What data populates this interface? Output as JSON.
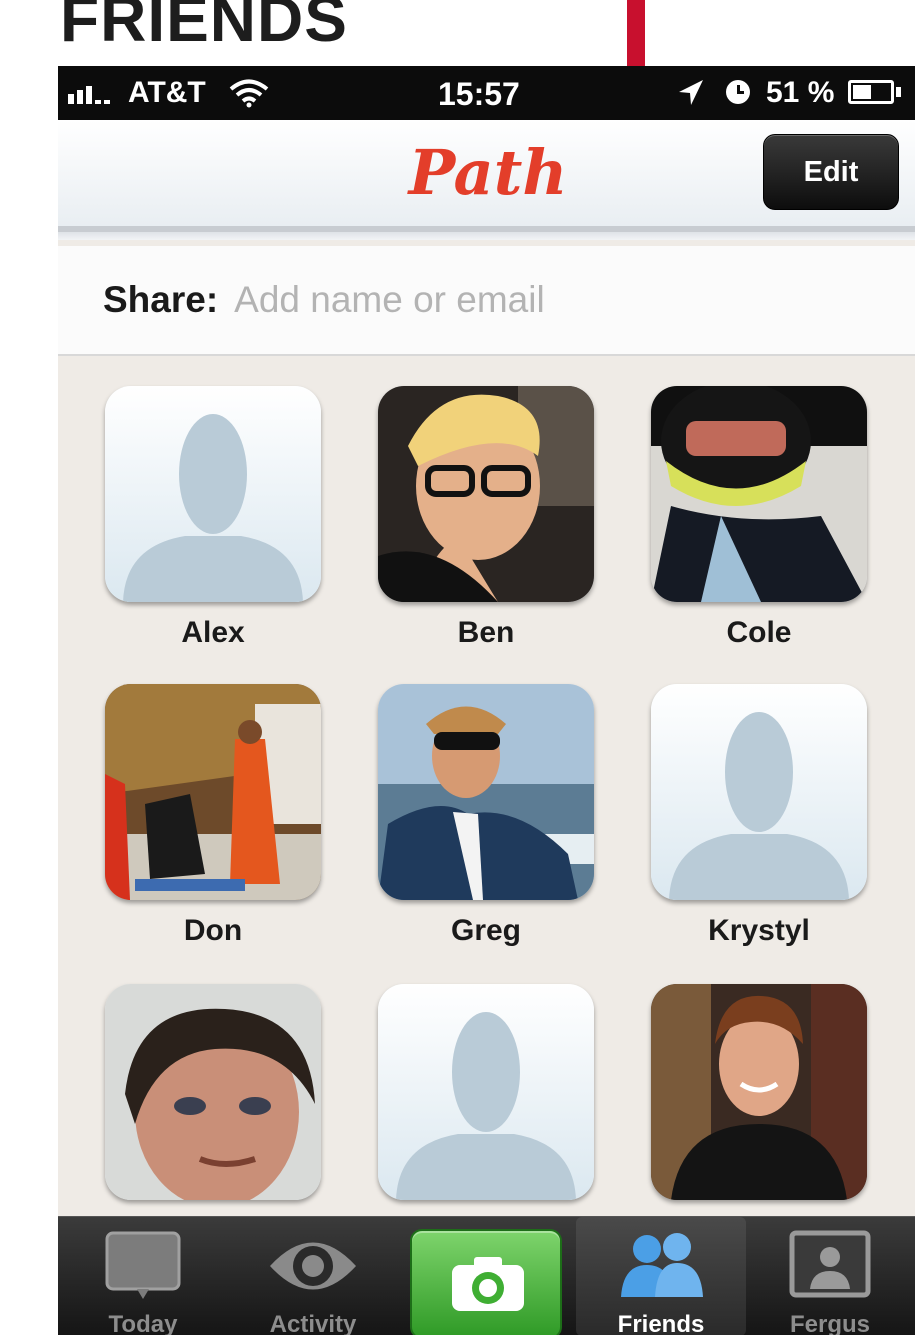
{
  "page": {
    "heading": "FRIENDS"
  },
  "status_bar": {
    "carrier": "AT&T",
    "time": "15:57",
    "battery_percent": "51 %",
    "battery_level": 0.51,
    "icons": [
      "signal-icon",
      "wifi-icon",
      "location-arrow-icon",
      "clock-icon",
      "battery-icon"
    ]
  },
  "nav": {
    "logo": "Path",
    "edit_label": "Edit"
  },
  "share": {
    "label": "Share:",
    "placeholder": "Add name or email"
  },
  "friends": [
    {
      "name": "Alex",
      "avatar": "placeholder-silhouette"
    },
    {
      "name": "Ben",
      "avatar": "photo"
    },
    {
      "name": "Cole",
      "avatar": "photo"
    },
    {
      "name": "Don",
      "avatar": "photo"
    },
    {
      "name": "Greg",
      "avatar": "photo"
    },
    {
      "name": "Krystyl",
      "avatar": "placeholder-silhouette"
    },
    {
      "name": "",
      "avatar": "photo"
    },
    {
      "name": "",
      "avatar": "placeholder-silhouette"
    },
    {
      "name": "",
      "avatar": "photo"
    }
  ],
  "tab_bar": {
    "tabs": [
      {
        "label": "Today",
        "icon": "today-icon"
      },
      {
        "label": "Activity",
        "icon": "eye-icon"
      },
      {
        "label": "",
        "icon": "camera-icon"
      },
      {
        "label": "Friends",
        "icon": "friends-icon",
        "active": true
      },
      {
        "label": "Fergus",
        "icon": "profile-icon"
      }
    ]
  },
  "colors": {
    "accent_red": "#c8102e",
    "logo_red": "#e33e2a",
    "camera_green": "#3fae33",
    "background": "#efebe6"
  }
}
